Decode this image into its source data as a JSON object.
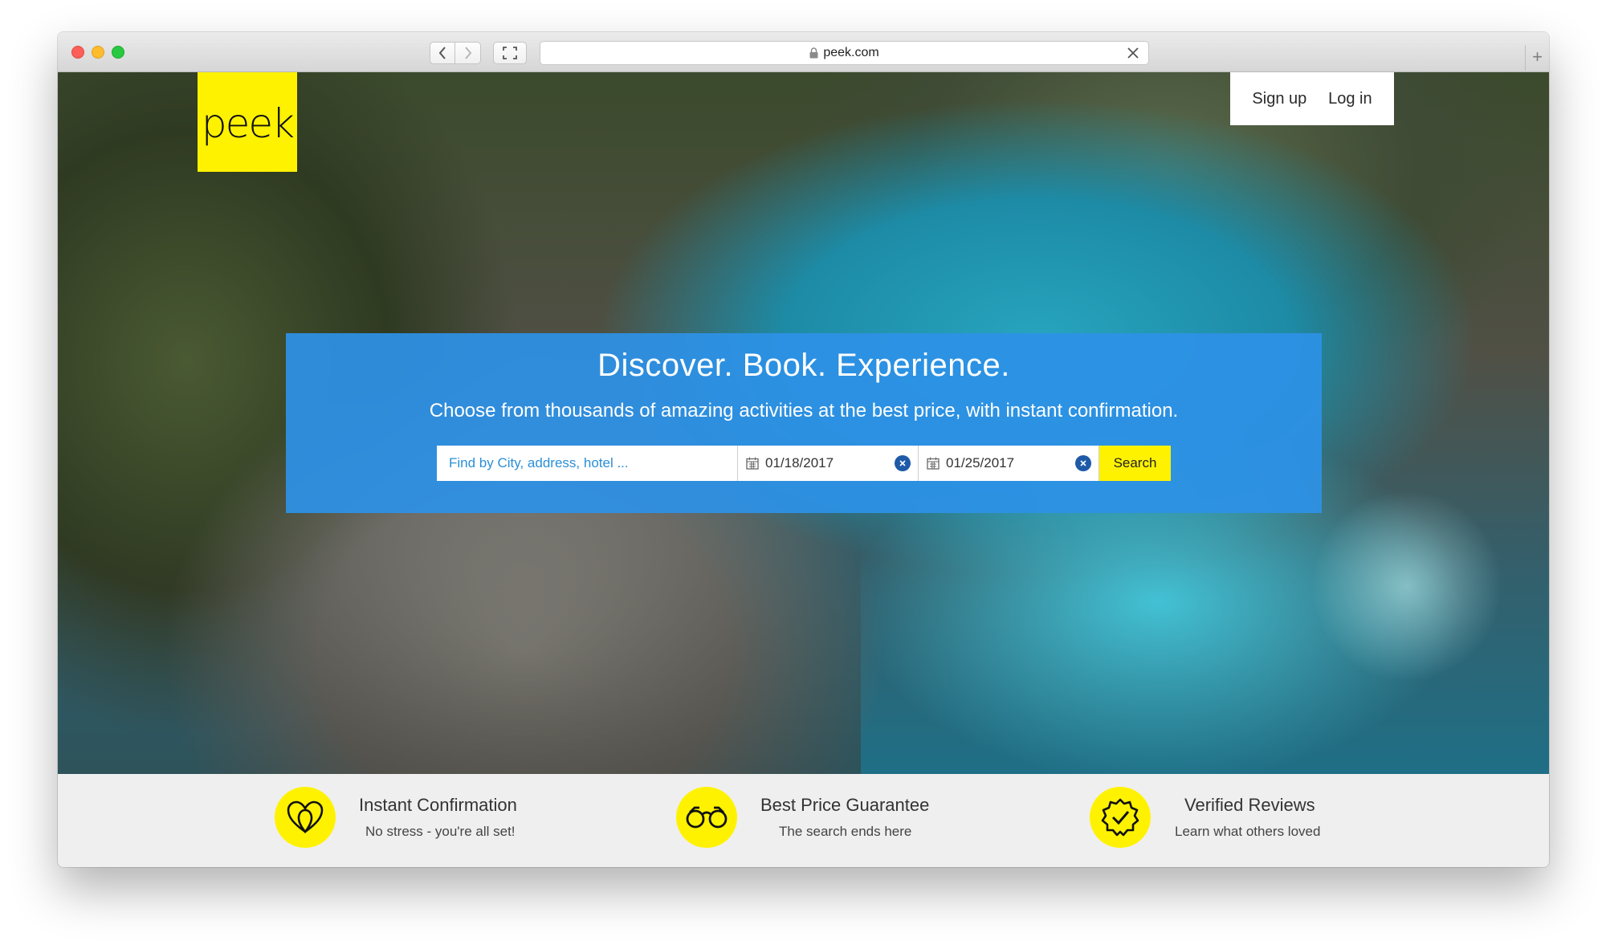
{
  "browser": {
    "url": "peek.com",
    "new_tab_label": "+"
  },
  "brand": {
    "logo_text": "peek",
    "accent_color": "#fff200",
    "panel_color": "#2d91e6"
  },
  "header": {
    "sign_up": "Sign up",
    "log_in": "Log in"
  },
  "hero": {
    "headline": "Discover. Book. Experience.",
    "subheadline": "Choose from thousands of amazing activities at the best price, with instant confirmation."
  },
  "search": {
    "location_placeholder": "Find by City, address, hotel ...",
    "start_date": "01/18/2017",
    "end_date": "01/25/2017",
    "button_label": "Search"
  },
  "features": [
    {
      "icon": "heart-icon",
      "title": "Instant Confirmation",
      "description": "No stress - you're all set!"
    },
    {
      "icon": "binoculars-icon",
      "title": "Best Price Guarantee",
      "description": "The search ends here"
    },
    {
      "icon": "badge-check-icon",
      "title": "Verified Reviews",
      "description": "Learn what others loved"
    }
  ]
}
